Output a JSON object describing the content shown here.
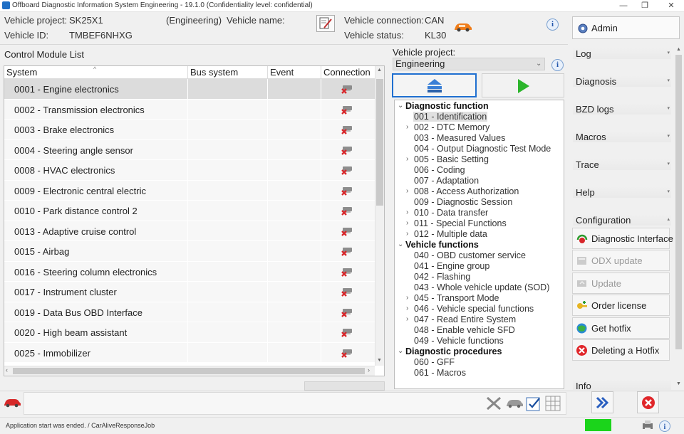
{
  "window": {
    "title": "Offboard Diagnostic Information System Engineering - 19.1.0 (Confidentiality level: confidential)"
  },
  "header": {
    "vehicle_project_label": "Vehicle project:",
    "vehicle_project_value": "SK25X1",
    "mode": "(Engineering)",
    "vehicle_name_label": "Vehicle name:",
    "vehicle_id_label": "Vehicle ID:",
    "vehicle_id_value": "TMBEF6NHXG",
    "vehicle_connection_label": "Vehicle connection:",
    "vehicle_connection_value": "CAN",
    "vehicle_status_label": "Vehicle status:",
    "vehicle_status_value": "KL30",
    "admin_label": "Admin"
  },
  "control_modules": {
    "title": "Control Module List",
    "columns": [
      "System",
      "Bus system",
      "Event",
      "Connection"
    ],
    "rows": [
      "0001 - Engine electronics",
      "0002 - Transmission electronics",
      "0003 - Brake electronics",
      "0004 - Steering angle sensor",
      "0008 - HVAC electronics",
      "0009 - Electronic central electric",
      "0010 - Park distance control 2",
      "0013 - Adaptive cruise control",
      "0015 - Airbag",
      "0016 - Steering column electronics",
      "0017 - Instrument cluster",
      "0019 - Data Bus OBD Interface",
      "0020 - High beam assistant",
      "0025 - Immobilizer"
    ]
  },
  "middle": {
    "vehicle_project_label": "Vehicle project:",
    "vehicle_project_selected": "Engineering"
  },
  "tree": {
    "groups": [
      {
        "label": "Diagnostic function",
        "items": [
          {
            "label": "001 - Identification",
            "expandable": false,
            "selected": true
          },
          {
            "label": "002 - DTC Memory",
            "expandable": true
          },
          {
            "label": "003 - Measured Values",
            "expandable": false
          },
          {
            "label": "004 - Output Diagnostic Test Mode",
            "expandable": false
          },
          {
            "label": "005 - Basic Setting",
            "expandable": true
          },
          {
            "label": "006 - Coding",
            "expandable": false
          },
          {
            "label": "007 - Adaptation",
            "expandable": false
          },
          {
            "label": "008 - Access Authorization",
            "expandable": true
          },
          {
            "label": "009 - Diagnostic Session",
            "expandable": false
          },
          {
            "label": "010 - Data transfer",
            "expandable": true
          },
          {
            "label": "011 - Special Functions",
            "expandable": true
          },
          {
            "label": "012 - Multiple data",
            "expandable": true
          }
        ]
      },
      {
        "label": "Vehicle functions",
        "items": [
          {
            "label": "040 - OBD customer service",
            "expandable": false
          },
          {
            "label": "041 - Engine group",
            "expandable": false
          },
          {
            "label": "042 - Flashing",
            "expandable": false
          },
          {
            "label": "043 - Whole vehicle update (SOD)",
            "expandable": false
          },
          {
            "label": "045 - Transport Mode",
            "expandable": true
          },
          {
            "label": "046 - Vehicle special functions",
            "expandable": true
          },
          {
            "label": "047 - Read Entire System",
            "expandable": true
          },
          {
            "label": "048 - Enable vehicle SFD",
            "expandable": false
          },
          {
            "label": "049 - Vehicle functions",
            "expandable": false
          }
        ]
      },
      {
        "label": "Diagnostic procedures",
        "items": [
          {
            "label": "060 - GFF",
            "expandable": false
          },
          {
            "label": "061 - Macros",
            "expandable": false
          }
        ]
      }
    ]
  },
  "right_panel": {
    "sections": [
      "Log",
      "Diagnosis",
      "BZD logs",
      "Macros",
      "Trace",
      "Help",
      "Configuration"
    ],
    "actions": [
      {
        "label": "Diagnostic Interface",
        "enabled": true,
        "icon": "diagnostic-interface-icon"
      },
      {
        "label": "ODX update",
        "enabled": false,
        "icon": "odx-update-icon"
      },
      {
        "label": "Update",
        "enabled": false,
        "icon": "update-icon"
      },
      {
        "label": "Order license",
        "enabled": true,
        "icon": "order-license-icon"
      },
      {
        "label": "Get hotfix",
        "enabled": true,
        "icon": "get-hotfix-icon"
      },
      {
        "label": "Deleting a Hotfix",
        "enabled": true,
        "icon": "delete-hotfix-icon"
      }
    ],
    "info_section": "Info"
  },
  "status": {
    "text": "Application start was ended. / CarAliveResponseJob",
    "indicator_color": "#1bd41b"
  },
  "colors": {
    "accent": "#1f6fd0",
    "selection": "#dcdcdc",
    "status_ok": "#1bd41b",
    "error": "#e0262a"
  }
}
